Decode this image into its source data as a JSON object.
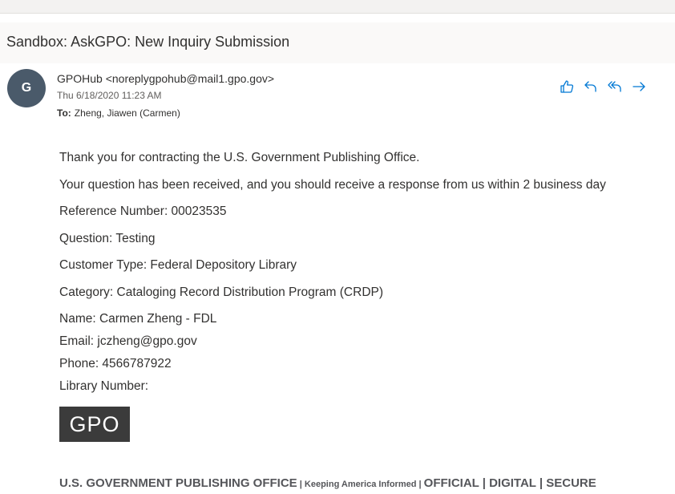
{
  "email": {
    "subject": "Sandbox: AskGPO: New Inquiry Submission",
    "avatar_initial": "G",
    "sender": "GPOHub <noreplygpohub@mail1.gpo.gov>",
    "datetime": "Thu 6/18/2020 11:23 AM",
    "to_label": "To:",
    "to_value": "Zheng, Jiawen (Carmen)"
  },
  "actions": {
    "like_icon": "thumbs-up-icon",
    "reply_icon": "reply-icon",
    "reply_all_icon": "reply-all-icon",
    "forward_icon": "forward-icon"
  },
  "body": {
    "lines": [
      "Thank you for contracting the U.S. Government Publishing Office.",
      "Your question has been received, and you should receive a response from us within 2 business day",
      "Reference Number: 00023535",
      "Question: Testing",
      "Customer Type: Federal Depository Library",
      "Category: Cataloging Record Distribution Program (CRDP)",
      "Name: Carmen Zheng - FDL",
      "Email: jczheng@gpo.gov",
      "Phone: 4566787922",
      "Library Number:"
    ],
    "logo_text": "GPO"
  },
  "footer": {
    "org": "U.S. GOVERNMENT PUBLISHING OFFICE",
    "sep1": " | ",
    "tagline": "Keeping America Informed",
    "sep2": " | ",
    "values": "OFFICIAL | DIGITAL | SECURE"
  },
  "colors": {
    "accent": "#0078d4",
    "logo_bg": "#3b3b3b",
    "avatar_bg": "#4a5a6a"
  }
}
